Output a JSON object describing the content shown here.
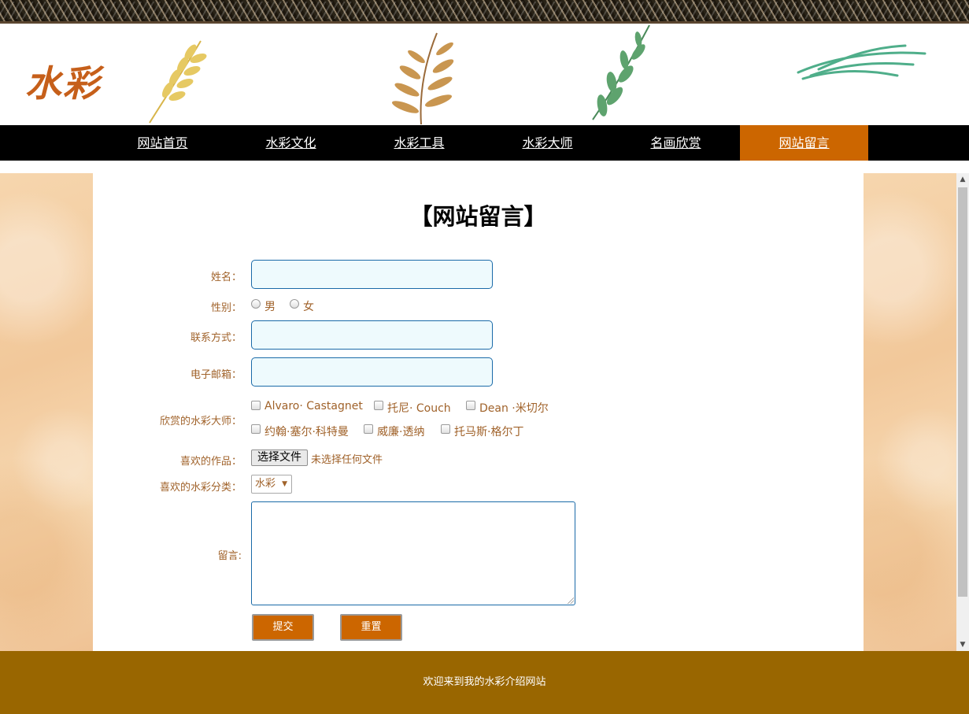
{
  "header": {
    "logo_text": "水彩"
  },
  "nav": {
    "items": [
      {
        "label": "网站首页"
      },
      {
        "label": "水彩文化"
      },
      {
        "label": "水彩工具"
      },
      {
        "label": "水彩大师"
      },
      {
        "label": "名画欣赏"
      },
      {
        "label": "网站留言"
      }
    ],
    "active_index": 5,
    "active_color": "#cc6600"
  },
  "form": {
    "title": "【网站留言】",
    "name_label": "姓名：",
    "name_value": "",
    "gender_label": "性别：",
    "gender_options": [
      "男",
      "女"
    ],
    "contact_label": "联系方式：",
    "contact_value": "",
    "email_label": "电子邮箱：",
    "email_value": "",
    "masters_label": "欣赏的水彩大师：",
    "masters_options": [
      "Alvaro· Castagnet",
      "托尼· Couch",
      "Dean ·米切尔",
      "约翰·塞尔·科特曼",
      "威廉·透纳",
      "托马斯·格尔丁"
    ],
    "works_label": "喜欢的作品：",
    "file_button_label": "选择文件",
    "file_status": "未选择任何文件",
    "category_label": "喜欢的水彩分类：",
    "category_selected": "水彩",
    "message_label": "留言:",
    "message_value": "",
    "submit_label": "提交",
    "reset_label": "重置"
  },
  "footer": {
    "text": "欢迎来到我的水彩介绍网站"
  },
  "colors": {
    "nav_bg": "#000000",
    "accent": "#cc6600",
    "label_text": "#a0622a",
    "footer_bg": "#996600",
    "input_bg": "#eefafd"
  },
  "icons": {
    "scroll_up": "chevron-up-icon",
    "scroll_down": "chevron-down-icon",
    "select_arrow": "caret-down-icon"
  }
}
